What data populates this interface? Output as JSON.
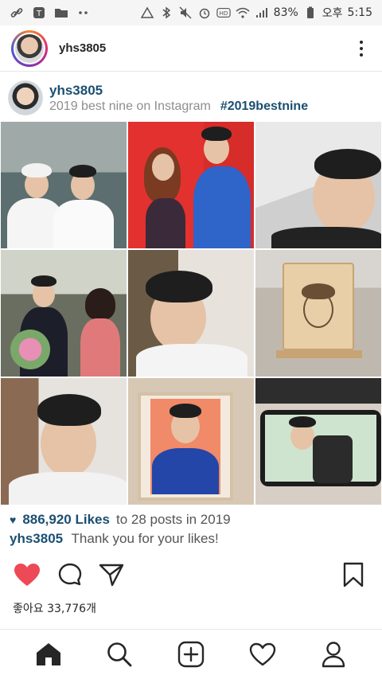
{
  "status_bar": {
    "battery_percent": "83%",
    "ampm": "오후",
    "time": "5:15"
  },
  "header": {
    "username": "yhs3805"
  },
  "post": {
    "username": "yhs3805",
    "subtitle": "2019 best nine on Instagram",
    "hashtag": "#2019bestnine",
    "likes_count": "886,920 Likes",
    "likes_suffix": "to 28 posts in 2019",
    "caption_user": "yhs3805",
    "caption_text": "Thank you for your likes!",
    "korean_likes": "좋아요 33,776개"
  },
  "colors": {
    "like_red": "#ed4956",
    "link_blue": "#1b4f72"
  },
  "icons": {
    "home": "home-icon",
    "search": "search-icon",
    "add": "add-post-icon",
    "activity": "heart-icon",
    "profile": "profile-icon"
  }
}
